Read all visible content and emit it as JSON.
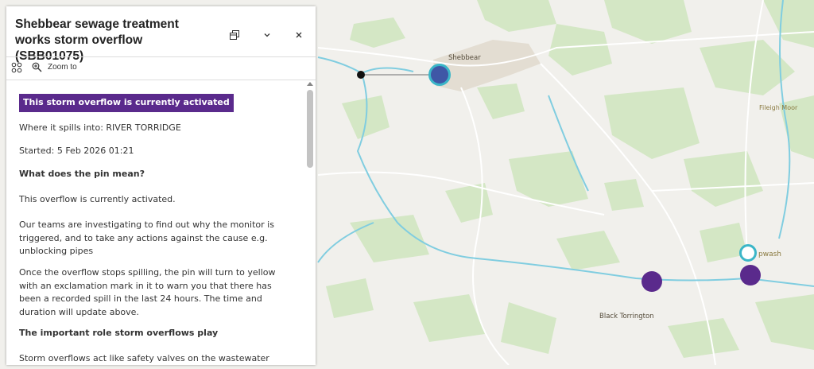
{
  "panel": {
    "title": "Shebbear sewage treatment works storm overflow (SBB01075)",
    "zoom_label": "Zoom to",
    "status": "This storm overflow is currently activated",
    "spills_into": "Where it spills into: RIVER TORRIDGE",
    "started": "Started: 5 Feb 2026 01:21",
    "pin_heading": "What does the pin mean?",
    "pin_p1": "This overflow is currently activated.",
    "pin_p2": "Our teams are investigating to find out why the monitor is triggered, and to take any actions against the cause e.g. unblocking pipes",
    "pin_p3": "Once the overflow stops spilling, the pin will turn to yellow with an exclamation mark in it to warn you that there has been a recorded spill in the last 24 hours. The time and duration will update above.",
    "role_heading": "The important role storm overflows play",
    "role_p1": "Storm overflows act like safety valves on the wastewater"
  },
  "map": {
    "places": {
      "shebbear": "Shebbear",
      "fileigh_moor": "Fileigh Moor",
      "black_torrington": "Black Torrington",
      "highampton_partial": "pwash"
    },
    "colors": {
      "active_pin": "#5a2a8c",
      "selected_pin": "#3f57a6",
      "selection_ring": "#3bb6c8",
      "river": "#80cde0",
      "woodland": "#d3e6c4"
    }
  }
}
